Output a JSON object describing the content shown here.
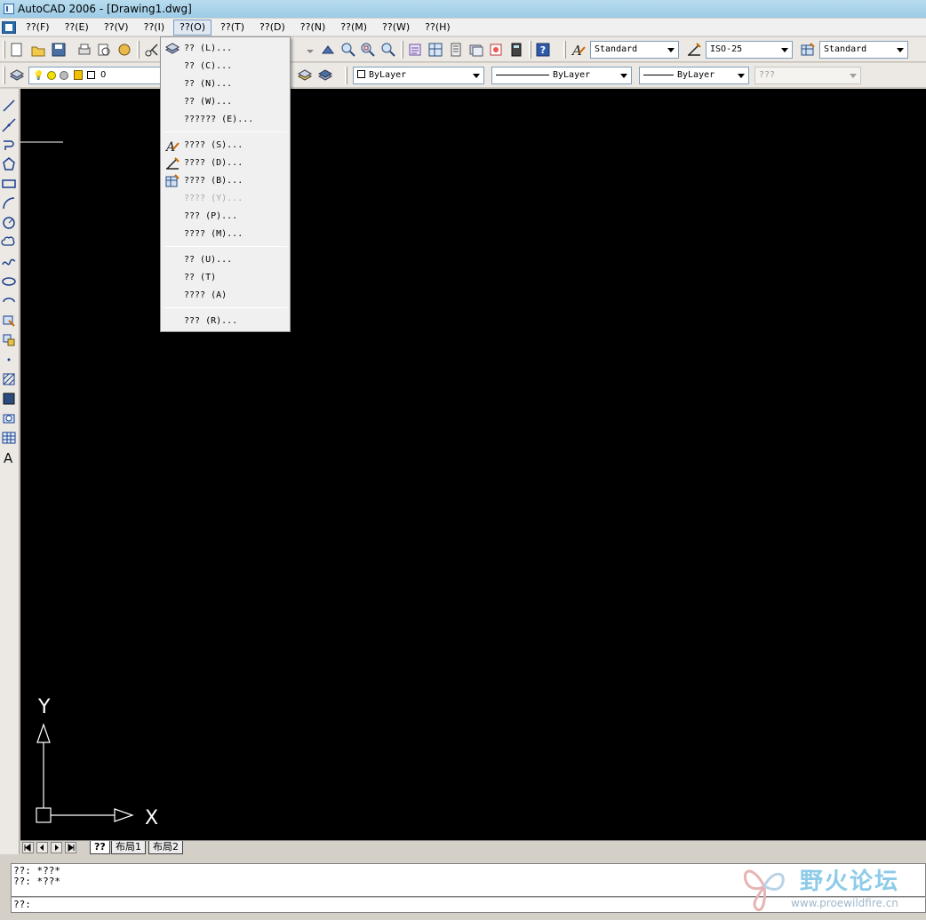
{
  "window": {
    "title": "AutoCAD 2006 - [Drawing1.dwg]"
  },
  "menubar": {
    "items": [
      {
        "label": "??(F)"
      },
      {
        "label": "??(E)"
      },
      {
        "label": "??(V)"
      },
      {
        "label": "??(I)"
      },
      {
        "label": "??(O)",
        "active": true
      },
      {
        "label": "??(T)"
      },
      {
        "label": "??(D)"
      },
      {
        "label": "??(N)"
      },
      {
        "label": "??(M)"
      },
      {
        "label": "??(W)"
      },
      {
        "label": "??(H)"
      }
    ]
  },
  "format_menu": {
    "items": [
      {
        "label": "?? (L)..."
      },
      {
        "label": "?? (C)..."
      },
      {
        "label": "?? (N)..."
      },
      {
        "label": "?? (W)..."
      },
      {
        "label": "?????? (E)..."
      },
      {
        "label": "???? (S)..."
      },
      {
        "label": "???? (D)..."
      },
      {
        "label": "???? (B)..."
      },
      {
        "label": "???? (Y)...",
        "disabled": true
      },
      {
        "label": "??? (P)..."
      },
      {
        "label": "???? (M)..."
      },
      {
        "label": "?? (U)..."
      },
      {
        "label": "?? (T)"
      },
      {
        "label": "???? (A)"
      },
      {
        "label": "??? (R)..."
      }
    ]
  },
  "styles_toolbar": {
    "text_style": "Standard",
    "dim_style": "ISO-25",
    "table_style": "Standard"
  },
  "layers_toolbar": {
    "current_layer": "0"
  },
  "properties_toolbar": {
    "color": "ByLayer",
    "linetype": "ByLayer",
    "lineweight": "ByLayer",
    "plot_style": "???"
  },
  "layout_tabs": [
    {
      "label": "??",
      "active": true
    },
    {
      "label": "布局1"
    },
    {
      "label": "布局2"
    }
  ],
  "ucs": {
    "x_label": "X",
    "y_label": "Y"
  },
  "command": {
    "history": [
      "??: *??*",
      "??: *??*"
    ],
    "prompt": "??:"
  },
  "watermark": {
    "title": "野火论坛",
    "url": "www.proewildfire.cn"
  },
  "colors": {
    "canvas": "#000000",
    "ucs": "#ffffff",
    "title_bg": "#b9dcef"
  }
}
